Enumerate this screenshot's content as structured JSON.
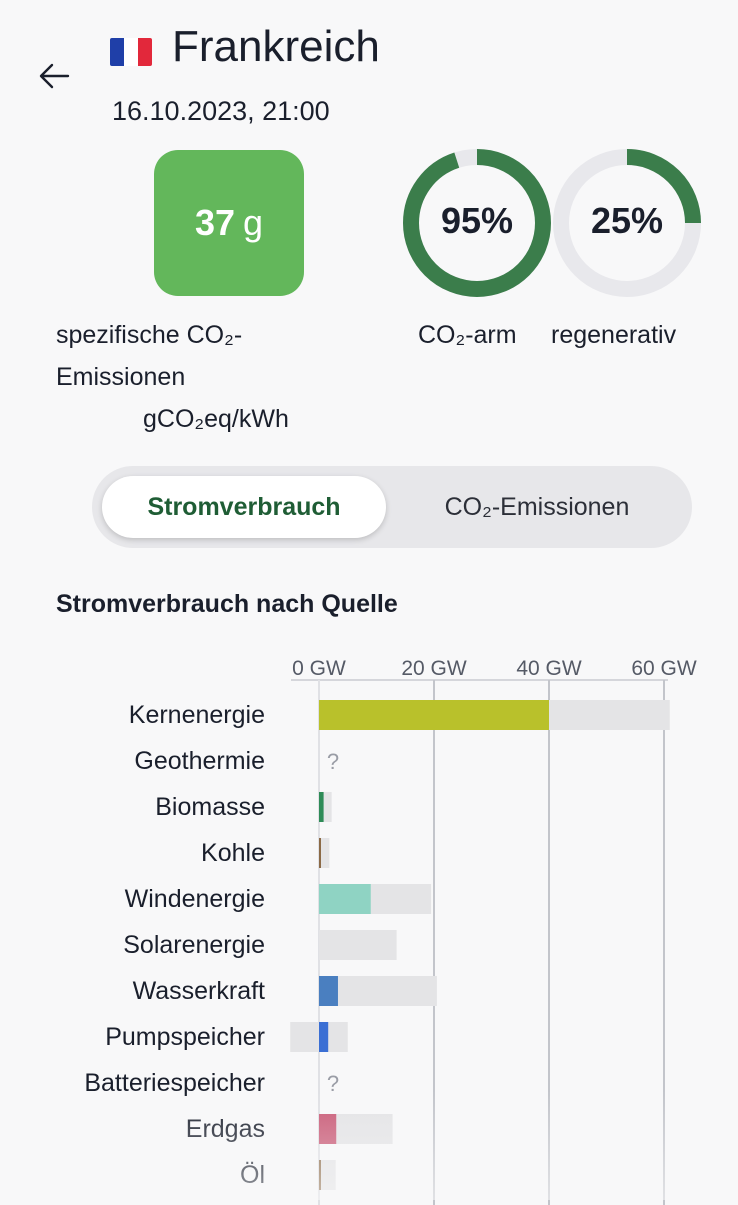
{
  "header": {
    "title": "Frankreich",
    "datetime": "16.10.2023, 21:00",
    "flag_colors": [
      "#1f3fa8",
      "#ffffff",
      "#e2283b"
    ]
  },
  "emission": {
    "value": "37",
    "unit": "g",
    "label_line1": "spezifische CO₂-",
    "label_line2": "Emissionen",
    "label_unit": "gCO₂eq/kWh",
    "color": "#63b75b"
  },
  "rings": [
    {
      "percent": 95,
      "text": "95%",
      "label": "CO₂-arm"
    },
    {
      "percent": 25,
      "text": "25%",
      "label": "regenerativ"
    }
  ],
  "ring_colors": {
    "fill": "#3b7d4b",
    "track": "#e8e8ec"
  },
  "toggle": {
    "active_label": "Stromverbrauch",
    "inactive_label": "CO₂-Emissionen"
  },
  "section_title": "Stromverbrauch nach Quelle",
  "chart_data": {
    "type": "bar",
    "orientation": "horizontal",
    "x_ticks": [
      "0 GW",
      "20 GW",
      "40 GW",
      "60 GW"
    ],
    "xlim": [
      -5,
      65
    ],
    "unknown_marker": "?",
    "rows": [
      {
        "label": "Kernenergie",
        "value": 40,
        "capacity": 61,
        "unknown": false,
        "color": "#b9c12b"
      },
      {
        "label": "Geothermie",
        "value": 0,
        "capacity": 0,
        "unknown": true,
        "color": "#999999"
      },
      {
        "label": "Biomasse",
        "value": 0.8,
        "capacity": 2.2,
        "unknown": false,
        "color": "#2e8b57"
      },
      {
        "label": "Kohle",
        "value": 0.2,
        "capacity": 1.8,
        "unknown": false,
        "color": "#8b6a47"
      },
      {
        "label": "Windenergie",
        "value": 9,
        "capacity": 19.5,
        "unknown": false,
        "color": "#8fd3c3"
      },
      {
        "label": "Solarenergie",
        "value": 0,
        "capacity": 13.5,
        "unknown": false,
        "color": "#f2c94c"
      },
      {
        "label": "Wasserkraft",
        "value": 3.3,
        "capacity": 20.5,
        "unknown": false,
        "color": "#4a7fc0"
      },
      {
        "label": "Pumpspeicher",
        "value": 1.6,
        "capacity": 5,
        "storage": 5,
        "unknown": false,
        "color": "#3b6fd4"
      },
      {
        "label": "Batteriespeicher",
        "value": 0,
        "capacity": 0,
        "unknown": true,
        "color": "#999999"
      },
      {
        "label": "Erdgas",
        "value": 3,
        "capacity": 12.8,
        "unknown": false,
        "color": "#c95a76"
      },
      {
        "label": "Öl",
        "value": 0.3,
        "capacity": 2.9,
        "unknown": false,
        "color": "#8b6a47"
      }
    ]
  }
}
